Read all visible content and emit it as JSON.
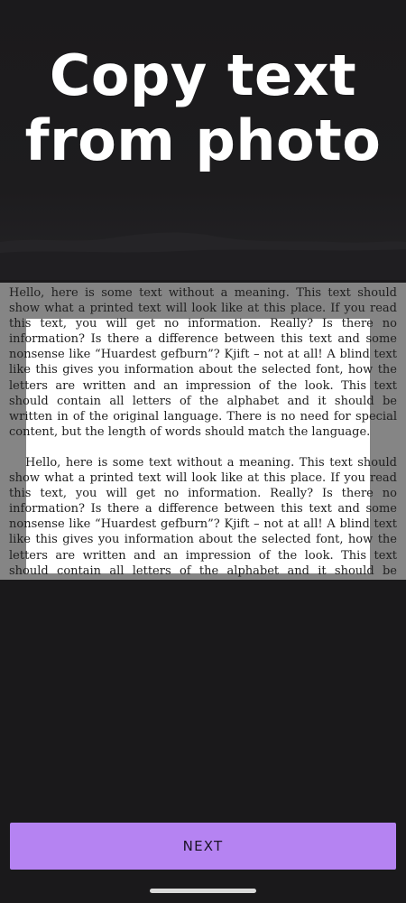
{
  "header": {
    "title_line1": "Copy text",
    "title_line2": "from photo"
  },
  "photo": {
    "paragraphs": [
      "Hello, here is some text without a meaning. This text should show what a printed text will look like at this place. If you read this text, you will get no information. Really? Is there no information? Is there a difference between this text and some nonsense like “Huardest gefburn”? Kjift – not at all! A blind text like this gives you information about the selected font, how the letters are written and an impression of the look. This text should contain all letters of the alphabet and it should be written in of the original language. There is no need for special content, but the length of words should match the language.",
      "Hello, here is some text without a meaning. This text should show what a printed text will look like at this place. If you read this text, you will get no information. Really? Is there no information? Is there a difference between this text and some nonsense like “Huardest gefburn”? Kjift – not at all! A blind text like this gives you information about the selected font, how the letters are written and an impression of the look. This text should contain all letters of the alphabet and it should be written in of the original language. There is no need for special content, but the length of words should match the language."
    ]
  },
  "footer": {
    "next_label": "NEXT"
  },
  "colors": {
    "background": "#1a191b",
    "accent": "#b583f2",
    "overlay": "#858585"
  }
}
